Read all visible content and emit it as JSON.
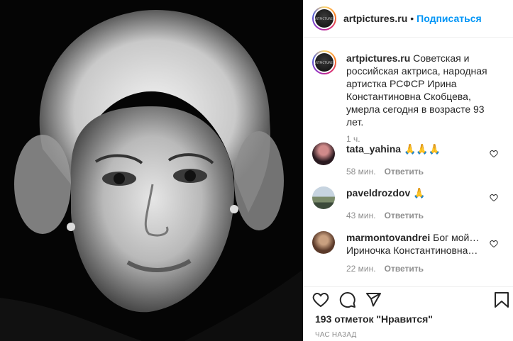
{
  "account": {
    "username": "artpictures.ru",
    "separator": "•",
    "follow_label": "Подписаться",
    "avatar_text": "ARTPICTURES"
  },
  "caption": {
    "username": "artpictures.ru",
    "text": "Советская и российская актриса, народная артистка РСФСР Ирина Константиновна Скобцева, умерла сегодня в возрасте 93 лет.",
    "time": "1 ч."
  },
  "comments": [
    {
      "username": "tata_yahina",
      "text": "🙏🙏🙏",
      "time": "58 мин.",
      "reply": "Ответить"
    },
    {
      "username": "paveldrozdov",
      "text": "🙏",
      "time": "43 мин.",
      "reply": "Ответить"
    },
    {
      "username": "marmontovandrei",
      "text": "Бог мой… Ириночка Константиновна…",
      "time": "22 мин.",
      "reply": "Ответить"
    }
  ],
  "footer": {
    "likes": "193 отметок \"Нравится\"",
    "posted": "ЧАС НАЗАД"
  },
  "icons": [
    "heart-icon",
    "comment-icon",
    "share-icon",
    "bookmark-icon"
  ],
  "colors": {
    "accent": "#0095f6",
    "muted": "#8e8e8e",
    "text": "#262626"
  }
}
